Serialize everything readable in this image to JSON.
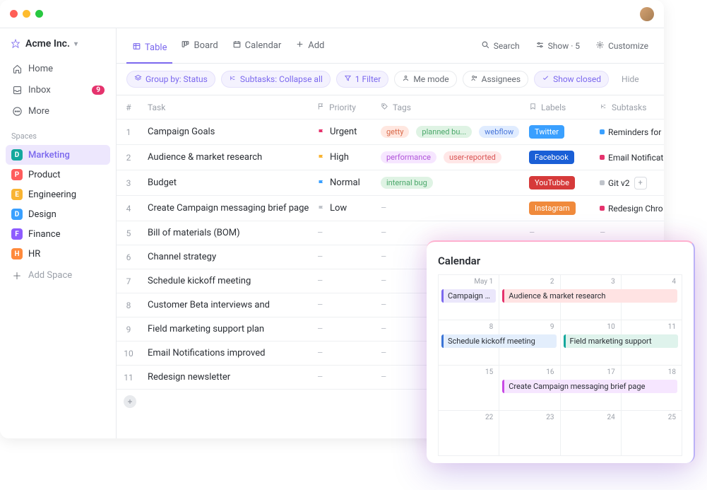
{
  "workspace": {
    "name": "Acme Inc."
  },
  "sidebar": {
    "nav": [
      {
        "icon": "home",
        "label": "Home"
      },
      {
        "icon": "inbox",
        "label": "Inbox",
        "badge": "9"
      },
      {
        "icon": "more",
        "label": "More"
      }
    ],
    "section": "Spaces",
    "spaces": [
      {
        "initial": "D",
        "label": "Marketing",
        "color": "#14a89d",
        "active": true
      },
      {
        "initial": "P",
        "label": "Product",
        "color": "#ff5d5d"
      },
      {
        "initial": "E",
        "label": "Engineering",
        "color": "#f9b433"
      },
      {
        "initial": "D",
        "label": "Design",
        "color": "#3aa0ff"
      },
      {
        "initial": "F",
        "label": "Finance",
        "color": "#8e5cff"
      },
      {
        "initial": "H",
        "label": "HR",
        "color": "#ff8a3c"
      }
    ],
    "add_space": "Add Space"
  },
  "toolbar": {
    "views": [
      {
        "icon": "table",
        "label": "Table",
        "active": true
      },
      {
        "icon": "board",
        "label": "Board"
      },
      {
        "icon": "calendar",
        "label": "Calendar"
      },
      {
        "icon": "plus",
        "label": "Add"
      }
    ],
    "right": {
      "search": "Search",
      "show": "Show · 5",
      "customize": "Customize"
    }
  },
  "filters": {
    "group": "Group by: Status",
    "subtasks": "Subtasks: Collapse all",
    "n_filters": "1 Filter",
    "me": "Me mode",
    "assignees": "Assignees",
    "closed": "Show closed",
    "hide": "Hide"
  },
  "table": {
    "headers": {
      "num": "#",
      "task": "Task",
      "priority": "Priority",
      "tags": "Tags",
      "labels": "Labels",
      "subtasks": "Subtasks"
    },
    "rows": [
      {
        "n": "1",
        "task": "Campaign Goals",
        "priority": {
          "name": "Urgent",
          "color": "#e5336d"
        },
        "tags": [
          {
            "t": "getty",
            "bg": "#ffe7e0",
            "fg": "#d96a4a"
          },
          {
            "t": "planned bu...",
            "bg": "#dff3e4",
            "fg": "#4aa76a"
          },
          {
            "t": "webflow",
            "bg": "#e0ecff",
            "fg": "#4a77d9"
          }
        ],
        "labels": [
          {
            "t": "Twitter",
            "bg": "#3aa0ff"
          }
        ],
        "sub": {
          "dot": "#3aa0ff",
          "t": "Reminders for"
        }
      },
      {
        "n": "2",
        "task": "Audience & market research",
        "priority": {
          "name": "High",
          "color": "#f9b433"
        },
        "tags": [
          {
            "t": "performance",
            "bg": "#f6e6ff",
            "fg": "#b054d9"
          },
          {
            "t": "user-reported",
            "bg": "#ffe7e7",
            "fg": "#d95454"
          }
        ],
        "labels": [
          {
            "t": "Facebook",
            "bg": "#1a5fd6"
          }
        ],
        "sub": {
          "dot": "#e5336d",
          "t": "Email Notificat"
        }
      },
      {
        "n": "3",
        "task": "Budget",
        "priority": {
          "name": "Normal",
          "color": "#3aa0ff"
        },
        "tags": [
          {
            "t": "internal bug",
            "bg": "#dff3e4",
            "fg": "#4aa76a"
          }
        ],
        "labels": [
          {
            "t": "YouTubbe",
            "bg": "#d63a3a"
          }
        ],
        "sub": {
          "dot": "#bfc3ca",
          "t": "Git v2",
          "add": true
        }
      },
      {
        "n": "4",
        "task": "Create Campaign messaging brief page",
        "priority": {
          "name": "Low",
          "color": "#bfc3ca"
        },
        "tags": [],
        "labels": [
          {
            "t": "Instagram",
            "bg": "#f08a3c"
          }
        ],
        "sub": {
          "dot": "#e5336d",
          "t": "Redesign Chro"
        }
      },
      {
        "n": "5",
        "task": "Bill of materials (BOM)"
      },
      {
        "n": "6",
        "task": "Channel strategy"
      },
      {
        "n": "7",
        "task": "Schedule kickoff meeting"
      },
      {
        "n": "8",
        "task": "Customer Beta interviews and"
      },
      {
        "n": "9",
        "task": "Field marketing support plan"
      },
      {
        "n": "10",
        "task": "Email Notifications improved"
      },
      {
        "n": "11",
        "task": "Redesign newsletter"
      }
    ]
  },
  "calendar": {
    "title": "Calendar",
    "days": [
      "May 1",
      "2",
      "3",
      "4",
      "8",
      "9",
      "10",
      "11",
      "15",
      "16",
      "17",
      "18",
      "22",
      "23",
      "24",
      "25"
    ],
    "events": [
      {
        "cell": 0,
        "span": 1,
        "t": "Campaign Goals",
        "bg": "#ebe7fb",
        "bc": "#7b68ee"
      },
      {
        "cell": 1,
        "span": 3,
        "t": "Audience & market research",
        "bg": "#ffe3e3",
        "bc": "#e5336d"
      },
      {
        "cell": 4,
        "span": 2,
        "t": "Schedule kickoff meeting",
        "bg": "#e3eefc",
        "bc": "#3a74d6"
      },
      {
        "cell": 6,
        "span": 2,
        "t": "Field marketing support",
        "bg": "#dff3ec",
        "bc": "#14a89d"
      },
      {
        "cell": 9,
        "span": 3,
        "t": "Create Campaign messaging brief page",
        "bg": "#f6e6ff",
        "bc": "#c84ae5"
      }
    ]
  }
}
